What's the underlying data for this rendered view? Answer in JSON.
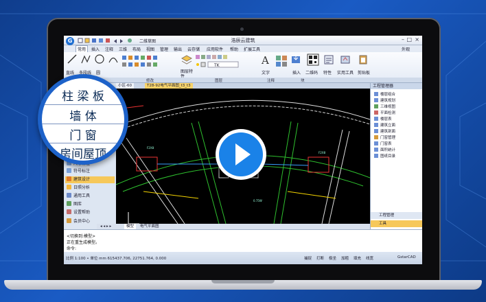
{
  "colors": {
    "accent": "#1a82e8",
    "ribbon_bg": "#e4ebf6",
    "canvas_bg": "#000000",
    "selected": "#f6c85a"
  },
  "window": {
    "title": "浩辰云建筑",
    "mode": "二维草图",
    "min": "–",
    "max": "□",
    "close": "×"
  },
  "menu": {
    "items": [
      "常用",
      "插入",
      "注释",
      "三维",
      "布局",
      "视图",
      "管理",
      "输出",
      "云存储",
      "应用软件",
      "帮助",
      "扩展工具"
    ],
    "skin": "外观"
  },
  "ribbon": {
    "labels": [
      "直线",
      "多段线",
      "圆",
      "图层特性",
      "文字",
      "插入",
      "二维码",
      "特性",
      "实用工具",
      "剪贴板"
    ],
    "groups": [
      "绘图",
      "修改",
      "图层",
      "注释",
      "块"
    ],
    "layer_name": "TK"
  },
  "tabs": {
    "doc_tab_1": "小区-60",
    "doc_tab_2": "T28-92电气平面图_t3_t3"
  },
  "model_tabs": {
    "model": "模型",
    "layout": "电气平面图"
  },
  "left_panel": {
    "items": [
      "尺寸标注",
      "符号标注",
      "建筑设计",
      "日照分析",
      "通用工具",
      "图库",
      "设置帮助",
      "会员中心"
    ]
  },
  "magnifier": {
    "rows": [
      "柱 梁 板",
      "墙   体",
      "门   窗",
      "房间屋顶"
    ]
  },
  "right_panel": {
    "header": "工程管理器",
    "items": [
      "楼层组合",
      "建筑规划",
      "三维视图",
      "平面检测",
      "楼层表",
      "建筑立面",
      "建筑剖面",
      "门窗管理",
      "门窗表",
      "面积统计",
      "图纸目录"
    ],
    "bottom_1": "工程管理",
    "bottom_2": "工具"
  },
  "command": {
    "line1": "<切换到:模型>",
    "line2": "正在重生成模型。",
    "line3": "命令:"
  },
  "status": {
    "text": "比例 1:100 • 单位 mm 615437.706, 22751.764, 0.000",
    "toggles": [
      "捕捉",
      "打断",
      "极坐",
      "加粗",
      "填充",
      "线宽"
    ],
    "brand": "GstarCAD"
  }
}
